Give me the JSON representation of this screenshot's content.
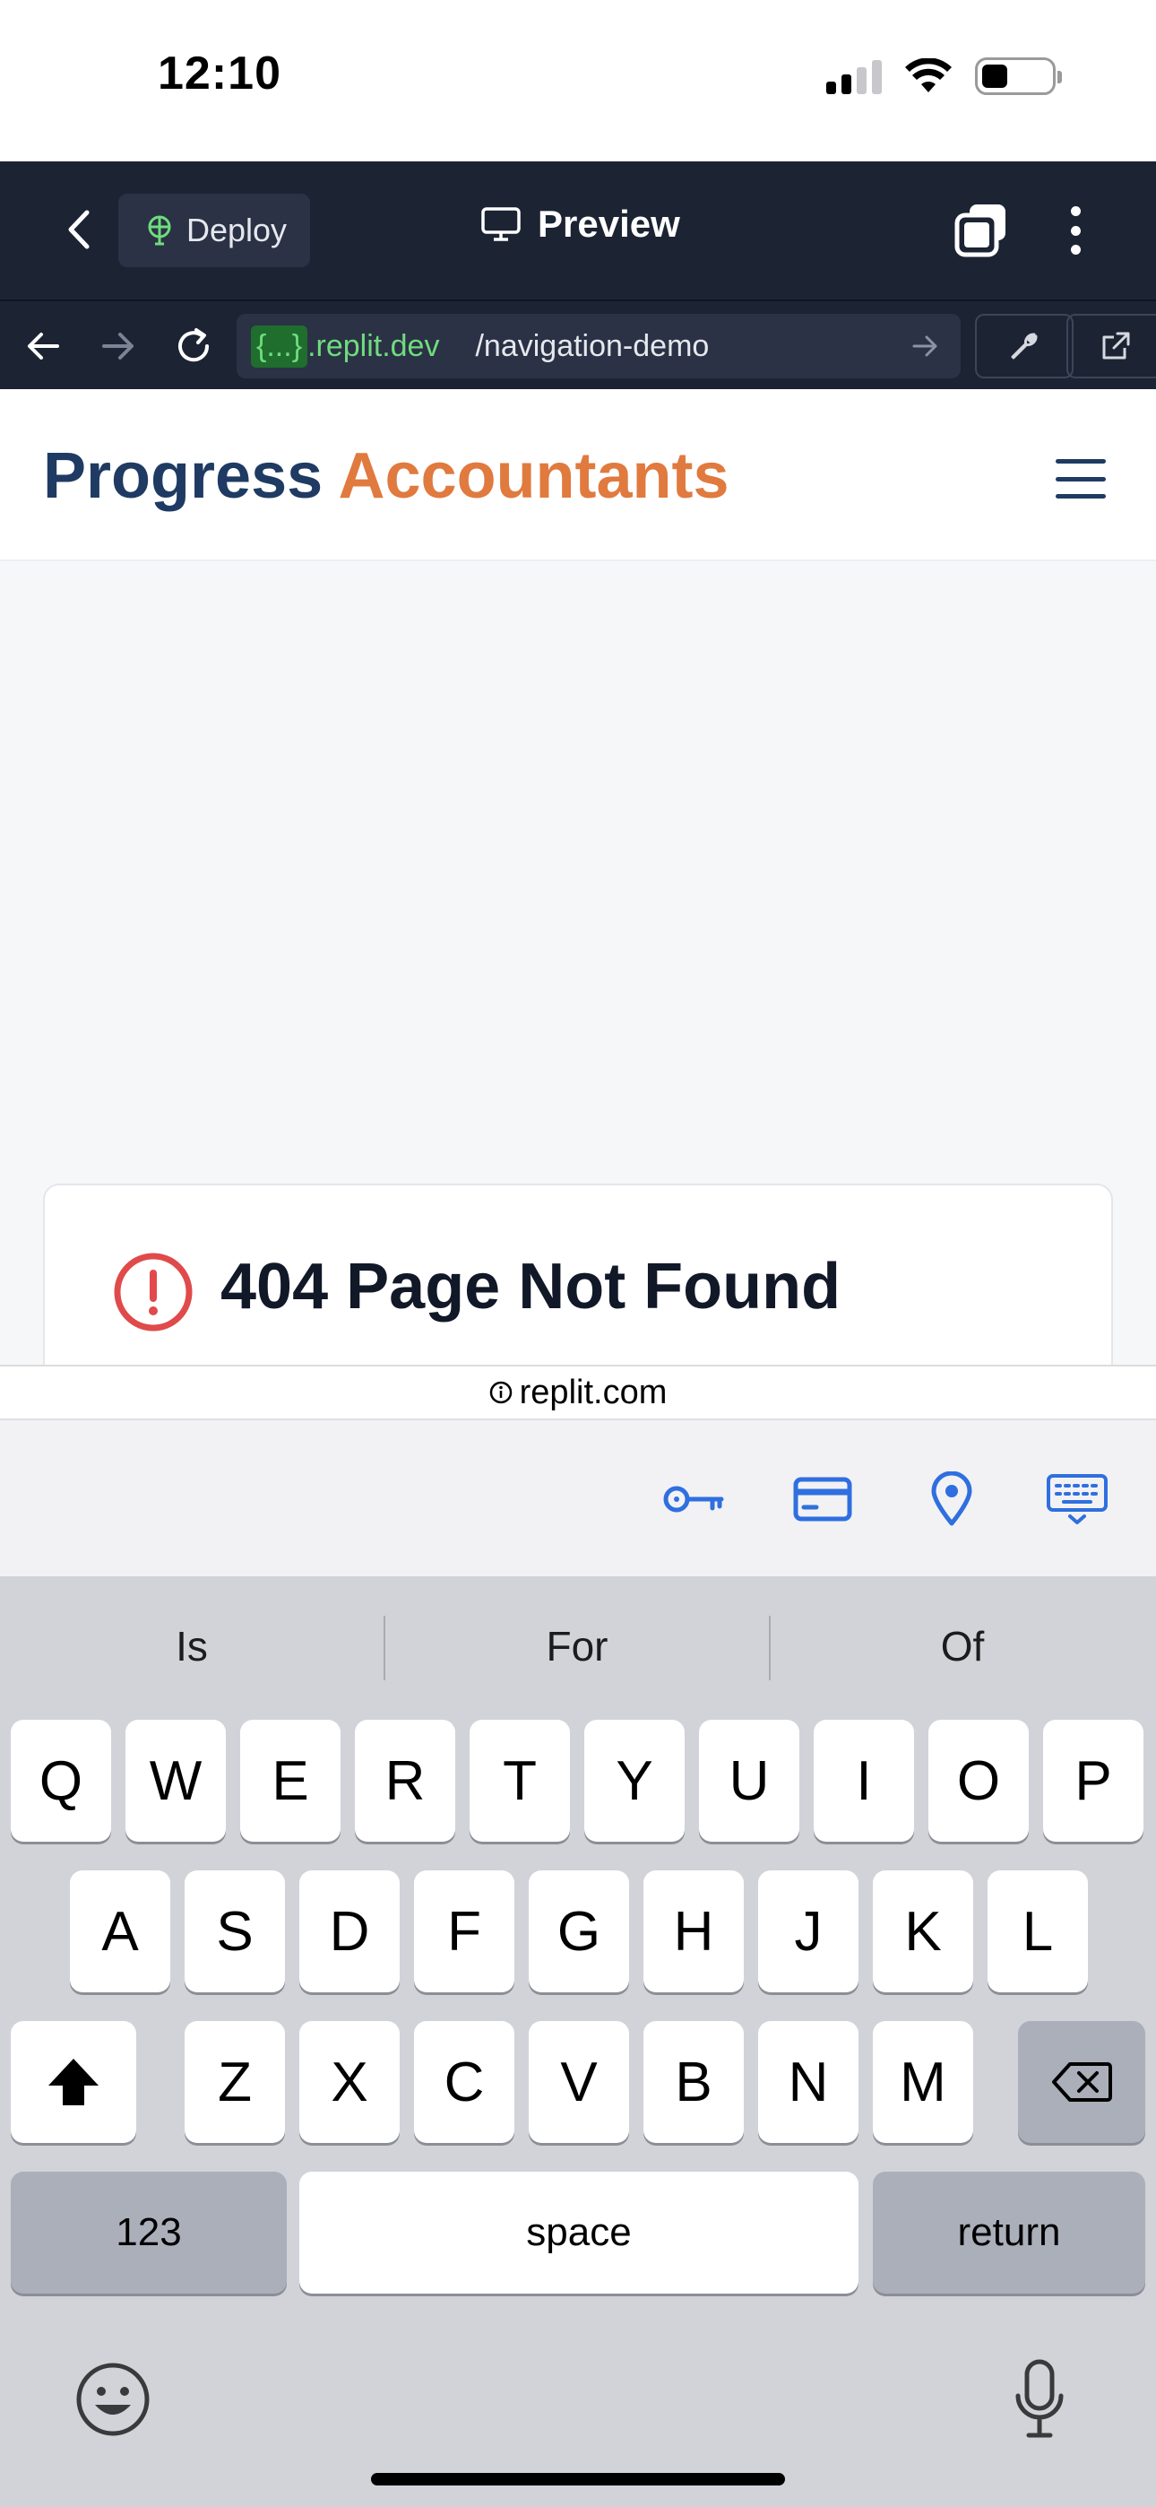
{
  "status_bar": {
    "time": "12:10"
  },
  "replit_bar": {
    "deploy_label": "Deploy",
    "preview_label": "Preview"
  },
  "url_bar": {
    "domain_tag": "{...}",
    "domain": ".replit.dev",
    "path": "/navigation-demo"
  },
  "site": {
    "brand_part1": "Progress",
    "brand_part2": "Accountants"
  },
  "error_card": {
    "title": "404 Page Not Found"
  },
  "domain_strip": {
    "domain": "replit.com"
  },
  "autofill": {
    "icons": [
      "key-icon",
      "credit-card-icon",
      "location-pin-icon",
      "keyboard-icon"
    ]
  },
  "keyboard": {
    "suggestions": [
      "Is",
      "For",
      "Of"
    ],
    "row1": [
      "Q",
      "W",
      "E",
      "R",
      "T",
      "Y",
      "U",
      "I",
      "O",
      "P"
    ],
    "row2": [
      "A",
      "S",
      "D",
      "F",
      "G",
      "H",
      "J",
      "K",
      "L"
    ],
    "row3": [
      "Z",
      "X",
      "C",
      "V",
      "B",
      "N",
      "M"
    ],
    "numbers_label": "123",
    "space_label": "space",
    "return_label": "return"
  },
  "colors": {
    "replit_bar": "#1c2333",
    "brand_primary": "#1f3b63",
    "brand_accent": "#e07a3f",
    "error_red": "#e04a4a",
    "autofill_blue": "#2f6fdf"
  }
}
